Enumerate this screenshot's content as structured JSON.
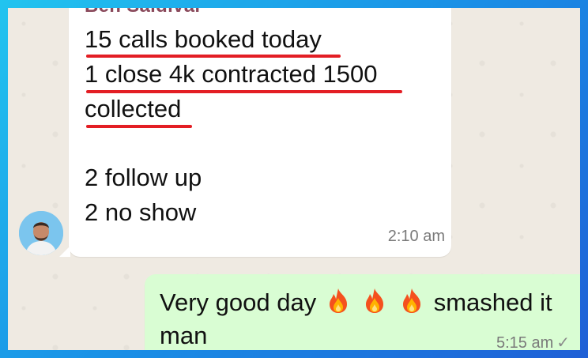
{
  "incoming_message": {
    "sender_name": "Ben Saldivar",
    "lines": [
      "15 calls booked today",
      "1 close 4k contracted 1500",
      "collected",
      "2 follow up",
      "2 no show"
    ],
    "time": "2:10 am"
  },
  "outgoing_message": {
    "text_before": "Very good day",
    "emoji": [
      "fire-emoji",
      "fire-emoji",
      "fire-emoji"
    ],
    "text_after": "smashed it man",
    "time": "5:15 am",
    "status": "✓"
  },
  "colors": {
    "underline": "#e31e24",
    "sender_name": "#8a4a5c",
    "outgoing_bubble": "#d9fdd3",
    "chat_background": "#efeae2"
  }
}
